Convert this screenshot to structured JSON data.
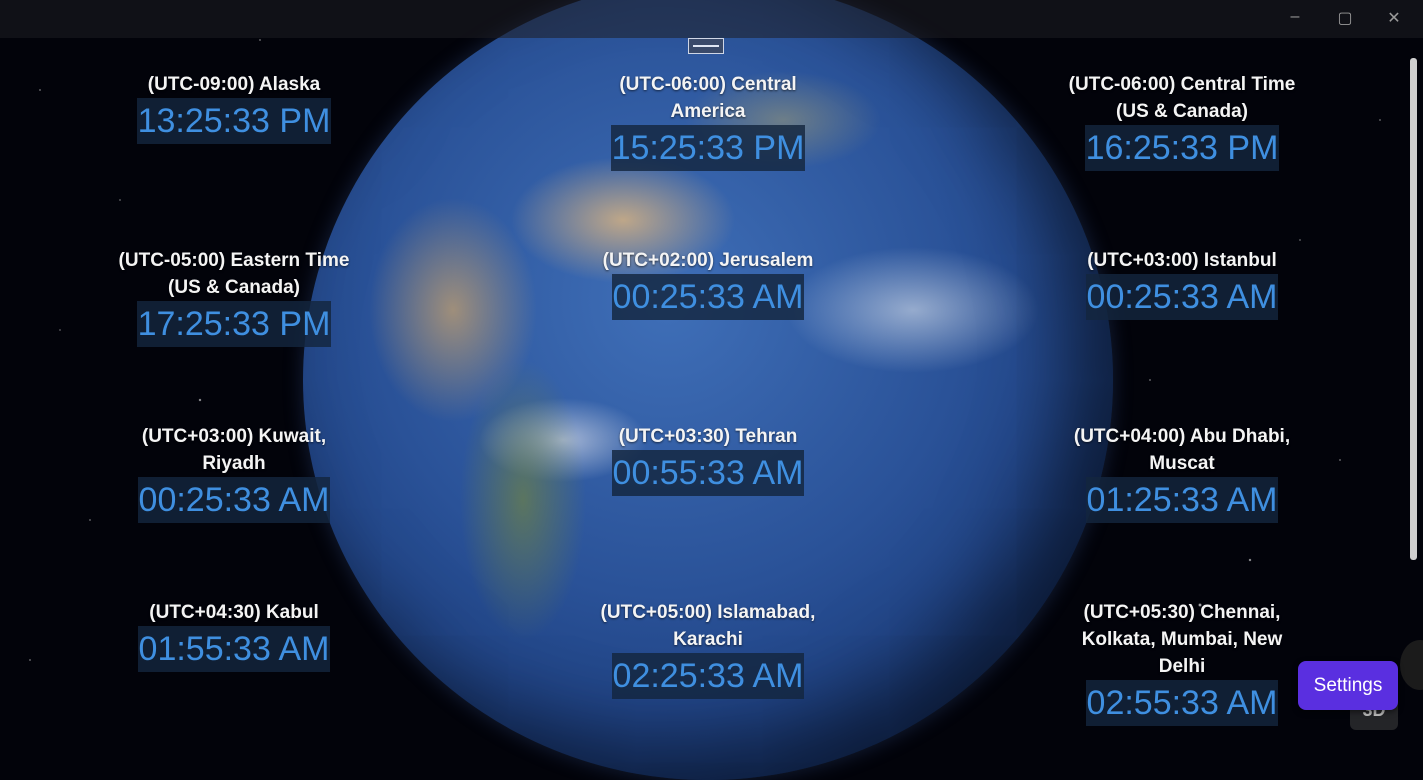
{
  "window": {
    "title": "",
    "minimize": "–",
    "maximize": "▢",
    "close": "✕"
  },
  "clocks": [
    {
      "tz": "(UTC-09:00) Alaska",
      "time": "13:25:33 PM"
    },
    {
      "tz": "(UTC-06:00) Central America",
      "time": "15:25:33 PM"
    },
    {
      "tz": "(UTC-06:00) Central Time (US & Canada)",
      "time": "16:25:33 PM"
    },
    {
      "tz": "(UTC-05:00) Eastern Time (US & Canada)",
      "time": "17:25:33 PM"
    },
    {
      "tz": "(UTC+02:00) Jerusalem",
      "time": "00:25:33 AM"
    },
    {
      "tz": "(UTC+03:00) Istanbul",
      "time": "00:25:33 AM"
    },
    {
      "tz": "(UTC+03:00) Kuwait, Riyadh",
      "time": "00:25:33 AM"
    },
    {
      "tz": "(UTC+03:30) Tehran",
      "time": "00:55:33 AM"
    },
    {
      "tz": "(UTC+04:00) Abu Dhabi, Muscat",
      "time": "01:25:33 AM"
    },
    {
      "tz": "(UTC+04:30) Kabul",
      "time": "01:55:33 AM"
    },
    {
      "tz": "(UTC+05:00) Islamabad, Karachi",
      "time": "02:25:33 AM"
    },
    {
      "tz": "(UTC+05:30) Chennai, Kolkata, Mumbai, New Delhi",
      "time": "02:55:33 AM"
    }
  ],
  "buttons": {
    "settings": "Settings",
    "view_3d": "3D"
  },
  "colors": {
    "accent": "#5a2fe0",
    "time_text": "#3f8fe0"
  }
}
